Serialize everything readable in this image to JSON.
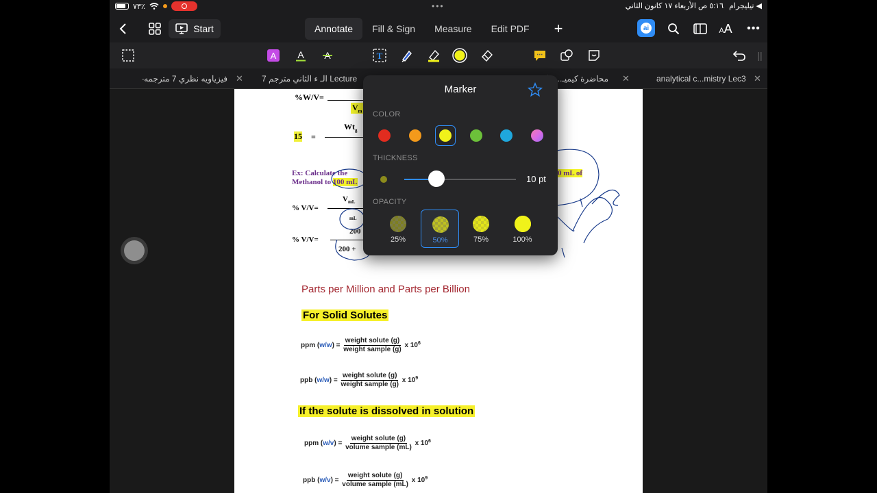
{
  "status_bar": {
    "battery": "٧٣٪",
    "datetime": "٥:١٦ ص  الأربعاء ١٧ كانون الثاني",
    "back_app": "◀ تيليجرام"
  },
  "toolbar": {
    "start_label": "Start",
    "modes": [
      "Annotate",
      "Fill & Sign",
      "Measure",
      "Edit PDF"
    ],
    "active_mode": "Annotate",
    "ai_label": "ai",
    "text_size_label": "AA"
  },
  "tabs": [
    {
      "label": "فيزياويه نظري 7 مترجمه-1"
    },
    {
      "label": "الـ ء الثاني مترجم 7 Lecture"
    },
    {
      "label": "محاضرة كيميـ...نظ"
    },
    {
      "label": "analytical c...mistry Lec3"
    }
  ],
  "marker_popover": {
    "title": "Marker",
    "color_label": "COLOR",
    "colors": [
      "#e22c1f",
      "#f49a1b",
      "#f1f21a",
      "#6cc13a",
      "#1fa7dc",
      "#d76ae6"
    ],
    "selected_color": "#f1f21a",
    "thickness_label": "THICKNESS",
    "thickness_value": "10 pt",
    "thickness_fraction": 0.29,
    "opacity_label": "OPACITY",
    "opacity_options": [
      "25%",
      "50%",
      "75%",
      "100%"
    ],
    "selected_opacity": "50%"
  },
  "pdf": {
    "wv_label": "%W/V=",
    "fifteen": "15",
    "eq": "=",
    "ex_text_1": "Ex: Calculate the",
    "ex_text_2": "Methanol to",
    "ex_hl": "100 mL",
    "ex_right": "0 mL of",
    "vv_label_1": "% V/V=",
    "vv_label_2": "% V/V=",
    "val_200": "200",
    "val_200_plus": "200 +",
    "heading_ppm": "Parts per Million and Parts per Billion",
    "heading_solid": "For Solid Solutes",
    "heading_solution": "If the solute is dissolved in solution",
    "ppm_ww": {
      "prefix": "ppm (",
      "unit": "w/w",
      "suffix": ") =",
      "num": "weight solute (g)",
      "den": "weight sample (g)",
      "mult": "x 10",
      "exp": "6"
    },
    "ppb_ww": {
      "prefix": "ppb (",
      "unit": "w/w",
      "suffix": ") =",
      "num": "weight solute (g)",
      "den": "weight sample (g)",
      "mult": "x 10",
      "exp": "9"
    },
    "ppm_wv": {
      "prefix": "ppm (",
      "unit": "w/v",
      "suffix": ") =",
      "num": "weight solute (g)",
      "den": "volume sample (mL)",
      "mult": "x 10",
      "exp": "6"
    },
    "ppb_wv": {
      "prefix": "ppb (",
      "unit": "w/v",
      "suffix": ") =",
      "num": "weight solute (g)",
      "den": "volume sample (mL)",
      "mult": "x 10",
      "exp": "9"
    }
  }
}
